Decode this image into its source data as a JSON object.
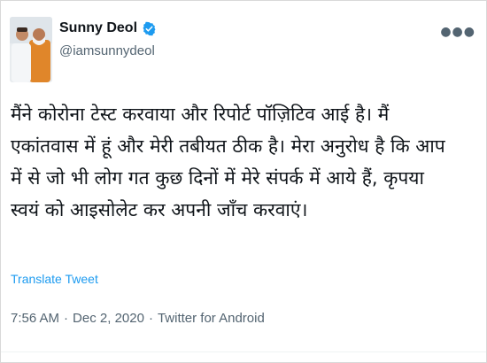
{
  "tweet": {
    "author": {
      "display_name": "Sunny Deol",
      "handle": "@iamsunnydeol",
      "verified": true
    },
    "text_lines": [
      "मैंने कोरोना टेस्ट करवाया और रिपोर्ट पॉज़िटिव आई है। मैं",
      "एकांतवास में हूं और मेरी तबीयत ठीक है। मेरा अनुरोध है कि आप",
      "में से जो भी लोग गत कुछ दिनों में मेरे संपर्क में आये हैं, कृपया",
      "स्वयं को आइसोलेट कर अपनी जाँच करवाएं।"
    ],
    "translate_label": "Translate Tweet",
    "timestamp": "7:56 AM",
    "separator": "·",
    "date": "Dec 2, 2020",
    "source": "Twitter for Android",
    "icons": {
      "verified": "verified-badge-icon",
      "more": "more-options-icon"
    },
    "colors": {
      "link": "#1d9bf0",
      "verified": "#1d9bf0",
      "muted": "#536471",
      "text": "#0f1419"
    }
  }
}
